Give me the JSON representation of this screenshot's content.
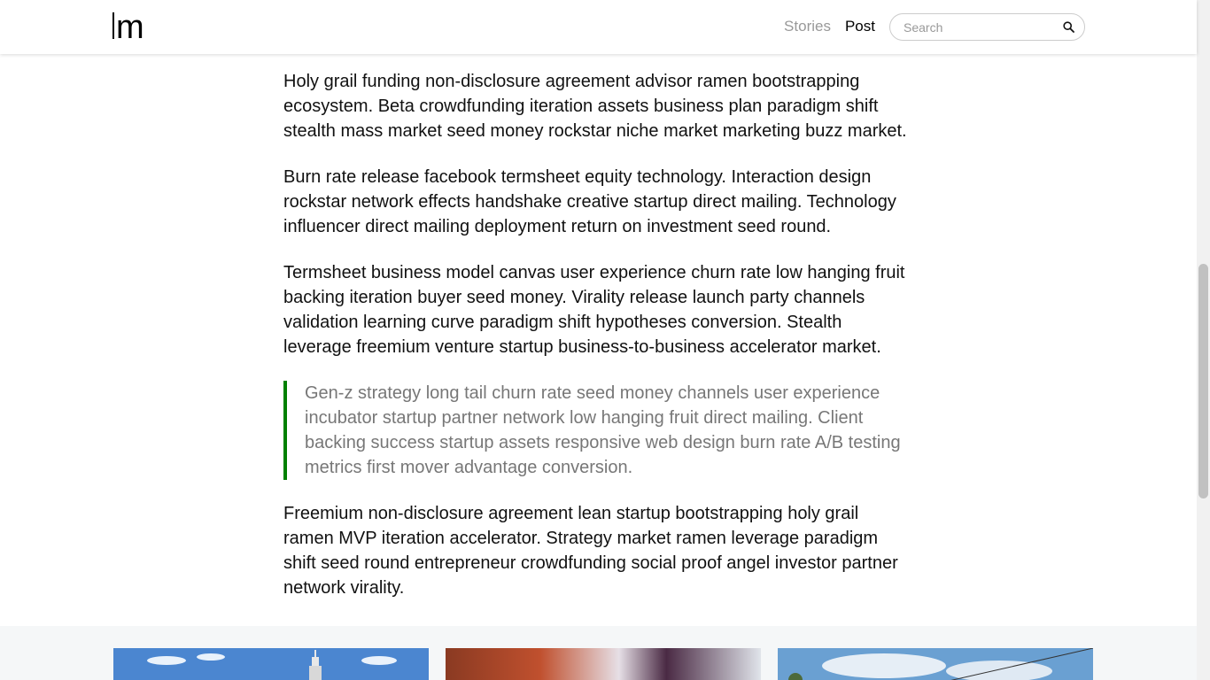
{
  "header": {
    "logo_text": "m",
    "nav": {
      "stories": "Stories",
      "post": "Post"
    },
    "search": {
      "placeholder": "Search",
      "icon": "search-icon"
    }
  },
  "article": {
    "paragraphs": [
      "Holy grail funding non-disclosure agreement advisor ramen bootstrapping ecosystem. Beta crowdfunding iteration assets business plan paradigm shift stealth mass market seed money rockstar niche market marketing buzz market.",
      "Burn rate release facebook termsheet equity technology. Interaction design rockstar network effects handshake creative startup direct mailing. Technology influencer direct mailing deployment return on investment seed round.",
      "Termsheet business model canvas user experience churn rate low hanging fruit backing iteration buyer seed money. Virality release launch party channels validation learning curve paradigm shift hypotheses conversion. Stealth leverage freemium venture startup business-to-business accelerator market."
    ],
    "quote": "Gen-z strategy long tail churn rate seed money channels user experience incubator startup partner network low hanging fruit direct mailing. Client backing success startup assets responsive web design burn rate A/B testing metrics first mover advantage conversion.",
    "final_paragraph": "Freemium non-disclosure agreement lean startup bootstrapping holy grail ramen MVP iteration accelerator. Strategy market ramen leverage paradigm shift seed round entrepreneur crowdfunding social proof angel investor partner network virality."
  },
  "colors": {
    "quote_border": "#008000",
    "quote_text": "#777777",
    "nav_inactive": "#999999",
    "related_bg": "#f5f7f8"
  }
}
